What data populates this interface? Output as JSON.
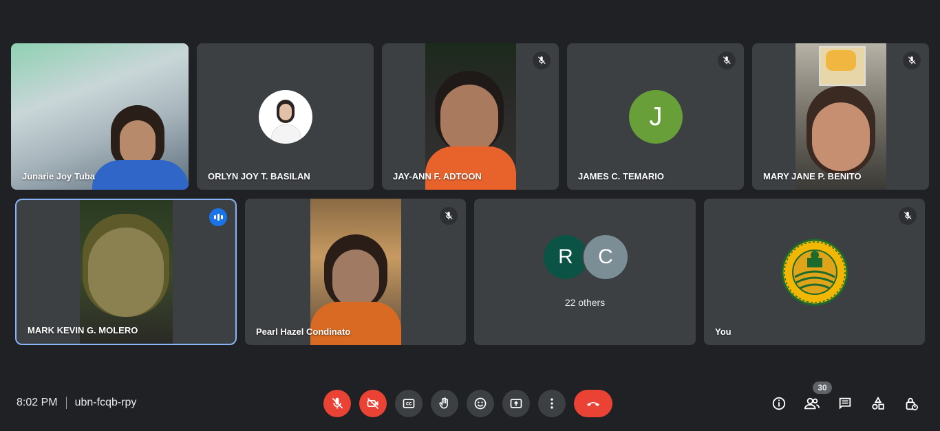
{
  "participants": [
    {
      "name": "Junarie Joy Tuba",
      "type": "video",
      "muted": false,
      "background": "#7a9a8a"
    },
    {
      "name": "ORLYN JOY T. BASILAN",
      "type": "photo-avatar",
      "muted": false
    },
    {
      "name": "JAY-ANN F. ADTOON",
      "type": "video",
      "muted": true,
      "background": "#2a2a28"
    },
    {
      "name": "JAMES C. TEMARIO",
      "type": "letter-avatar",
      "initial": "J",
      "avatar_color": "#689f38",
      "muted": true
    },
    {
      "name": "MARY JANE P. BENITO",
      "type": "video",
      "muted": true,
      "background": "#6b6a64"
    },
    {
      "name": "MARK KEVIN G. MOLERO",
      "type": "video",
      "muted": false,
      "speaking": true,
      "background": "#2d3a24"
    },
    {
      "name": "Pearl Hazel Condinato",
      "type": "video",
      "muted": true,
      "background": "#6d5a3e"
    },
    {
      "type": "others",
      "label": "22 others",
      "avatars": [
        {
          "initial": "R",
          "color": "#0b5345"
        },
        {
          "initial": "C",
          "color": "#7b8e96"
        }
      ]
    },
    {
      "name": "You",
      "type": "logo-avatar",
      "muted": true
    }
  ],
  "meeting": {
    "time": "8:02 PM",
    "code": "ubn-fcqb-rpy",
    "participant_count": "30"
  },
  "controls": [
    "mic-off",
    "camera-off",
    "captions",
    "raise-hand",
    "emoji",
    "present",
    "more-options",
    "leave-call"
  ],
  "right_controls": [
    "meeting-details",
    "people",
    "chat",
    "activities",
    "host-controls"
  ],
  "colors": {
    "background": "#202124",
    "tile": "#3c4043",
    "danger": "#ea4335",
    "active_outline": "#8ab4f8",
    "speaking": "#1a73e8"
  }
}
